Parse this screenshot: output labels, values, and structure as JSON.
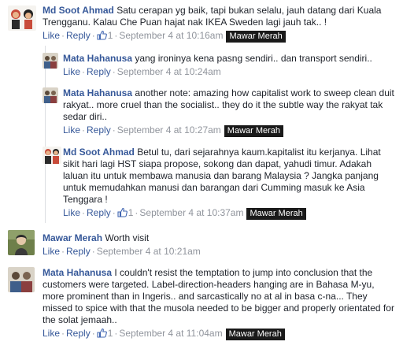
{
  "comments": [
    {
      "author": "Md Soot Ahmad",
      "text": "Satu cerapan yg baik, tapi bukan selalu, jauh datang dari Kuala Trengganu. Kalau Che Puan hajat nak IKEA Sweden lagi jauh tak.. !",
      "like": "Like",
      "reply": "Reply",
      "likes": "1",
      "time": "September 4 at 10:16am",
      "tag": "Mawar Merah"
    },
    {
      "author": "Mata Hahanusa",
      "text": "yang ironinya kena pasng sendiri.. dan transport sendiri..",
      "like": "Like",
      "reply": "Reply",
      "time": "September 4 at 10:24am"
    },
    {
      "author": "Mata Hahanusa",
      "text": "another note: amazing how capitalist work to sweep clean duit rakyat.. more cruel than the socialist.. they do it the subtle way the rakyat tak sedar diri..",
      "like": "Like",
      "reply": "Reply",
      "time": "September 4 at 10:27am",
      "tag": "Mawar Merah"
    },
    {
      "author": "Md Soot Ahmad",
      "text": "Betul tu, dari sejarahnya kaum.kapitalist itu kerjanya. Lihat sikit hari lagi HST siapa propose, sokong dan dapat, yahudi timur. Adakah laluan itu untuk membawa manusia dan barang Malaysia ? Jangka panjang untuk memudahkan manusi dan barangan dari Cumming masuk ke Asia Tenggara !",
      "like": "Like",
      "reply": "Reply",
      "likes": "1",
      "time": "September 4 at 10:37am",
      "tag": "Mawar Merah"
    },
    {
      "author": "Mawar Merah",
      "text": "Worth visit",
      "like": "Like",
      "reply": "Reply",
      "time": "September 4 at 10:21am"
    },
    {
      "author": "Mata Hahanusa",
      "text": "I couldn't resist the temptation to jump into conclusion that the customers were targeted. Label-direction-headers hanging are in Bahasa M-yu, more prominent than in Ingeris.. and sarcastically no at al in basa c-na... They missed to spice with that the musola needed to be bigger and properly orientated for the solat jemaah..",
      "like": "Like",
      "reply": "Reply",
      "likes": "1",
      "time": "September 4 at 11:04am",
      "tag": "Mawar Merah"
    }
  ],
  "separator": "·",
  "icons": {
    "like": "thumbs-up-icon",
    "avatar": "user-avatar"
  },
  "colors": {
    "link": "#365899",
    "meta": "#90949c",
    "tag_bg": "#1a1a1a"
  }
}
